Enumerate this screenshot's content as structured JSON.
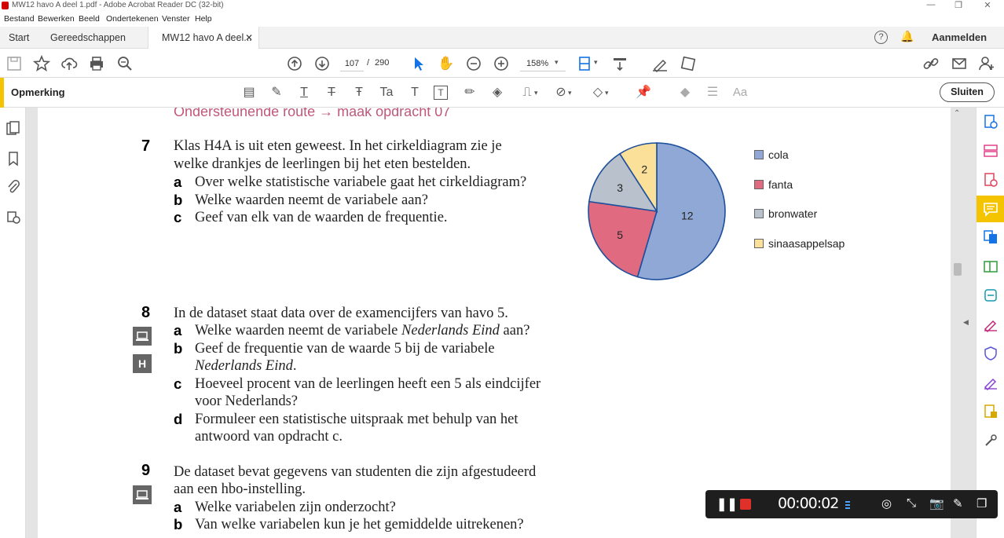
{
  "window": {
    "title": "MW12 havo A deel 1.pdf - Adobe Acrobat Reader DC (32-bit)"
  },
  "menu": [
    "Bestand",
    "Bewerken",
    "Beeld",
    "Ondertekenen",
    "Venster",
    "Help"
  ],
  "tabs": {
    "start": "Start",
    "tools": "Gereedschappen",
    "document": "MW12 havo A deel..."
  },
  "account": {
    "signin": "Aanmelden"
  },
  "toolbar": {
    "page_current": "107",
    "page_sep": "/",
    "page_total": "290",
    "zoom": "158%"
  },
  "comment_bar": {
    "title": "Opmerking",
    "close": "Sluiten"
  },
  "document": {
    "cut_heading": "Ondersteunende route → maak opdracht 07",
    "q7": {
      "num": "7",
      "lines": [
        "Klas H4A is uit eten geweest. In het cirkeldiagram zie je",
        "welke drankjes de leerlingen bij het eten bestelden."
      ],
      "items": [
        {
          "letter": "a",
          "text": "Over welke statistische variabele gaat het cirkeldiagram?"
        },
        {
          "letter": "b",
          "text": "Welke waarden neemt de variabele aan?"
        },
        {
          "letter": "c",
          "text": "Geef van elk van de waarden de frequentie."
        }
      ]
    },
    "q8": {
      "num": "8",
      "line": "In de dataset staat data over de examencijfers van havo 5.",
      "badge_h": "H",
      "a_pre": "Welke waarden neemt de variabele ",
      "a_italic": "Nederlands Eind",
      "a_post": " aan?",
      "b_line1": "Geef de frequentie van de waarde 5 bij de variabele",
      "b_italic": "Nederlands Eind",
      "b_post": ".",
      "c_line1": "Hoeveel procent van de leerlingen heeft een 5 als eindcijfer",
      "c_line2": "voor Nederlands?",
      "d_line1": "Formuleer een statistische uitspraak met behulp van het",
      "d_line2": "antwoord van opdracht c.",
      "letters": [
        "a",
        "b",
        "c",
        "d"
      ]
    },
    "q9": {
      "num": "9",
      "lines": [
        "De dataset bevat gegevens van studenten die zijn afgestudeerd",
        "aan een hbo-instelling."
      ],
      "items": [
        {
          "letter": "a",
          "text": "Welke variabelen zijn onderzocht?"
        },
        {
          "letter": "b",
          "text": "Van welke variabelen kun je het gemiddelde uitrekenen?"
        }
      ]
    }
  },
  "chart_data": {
    "type": "pie",
    "categories": [
      "cola",
      "fanta",
      "bronwater",
      "sinaasappelsap"
    ],
    "values": [
      12,
      5,
      3,
      2
    ],
    "colors": [
      "#8fa8d6",
      "#e06a80",
      "#b8c1cc",
      "#fbe09a"
    ],
    "legend_position": "right"
  },
  "recorder": {
    "time": "00:00:02"
  },
  "colors": {
    "accent": "#f5c400",
    "heading_pink": "#c0587a",
    "link_blue": "#1473e6"
  }
}
